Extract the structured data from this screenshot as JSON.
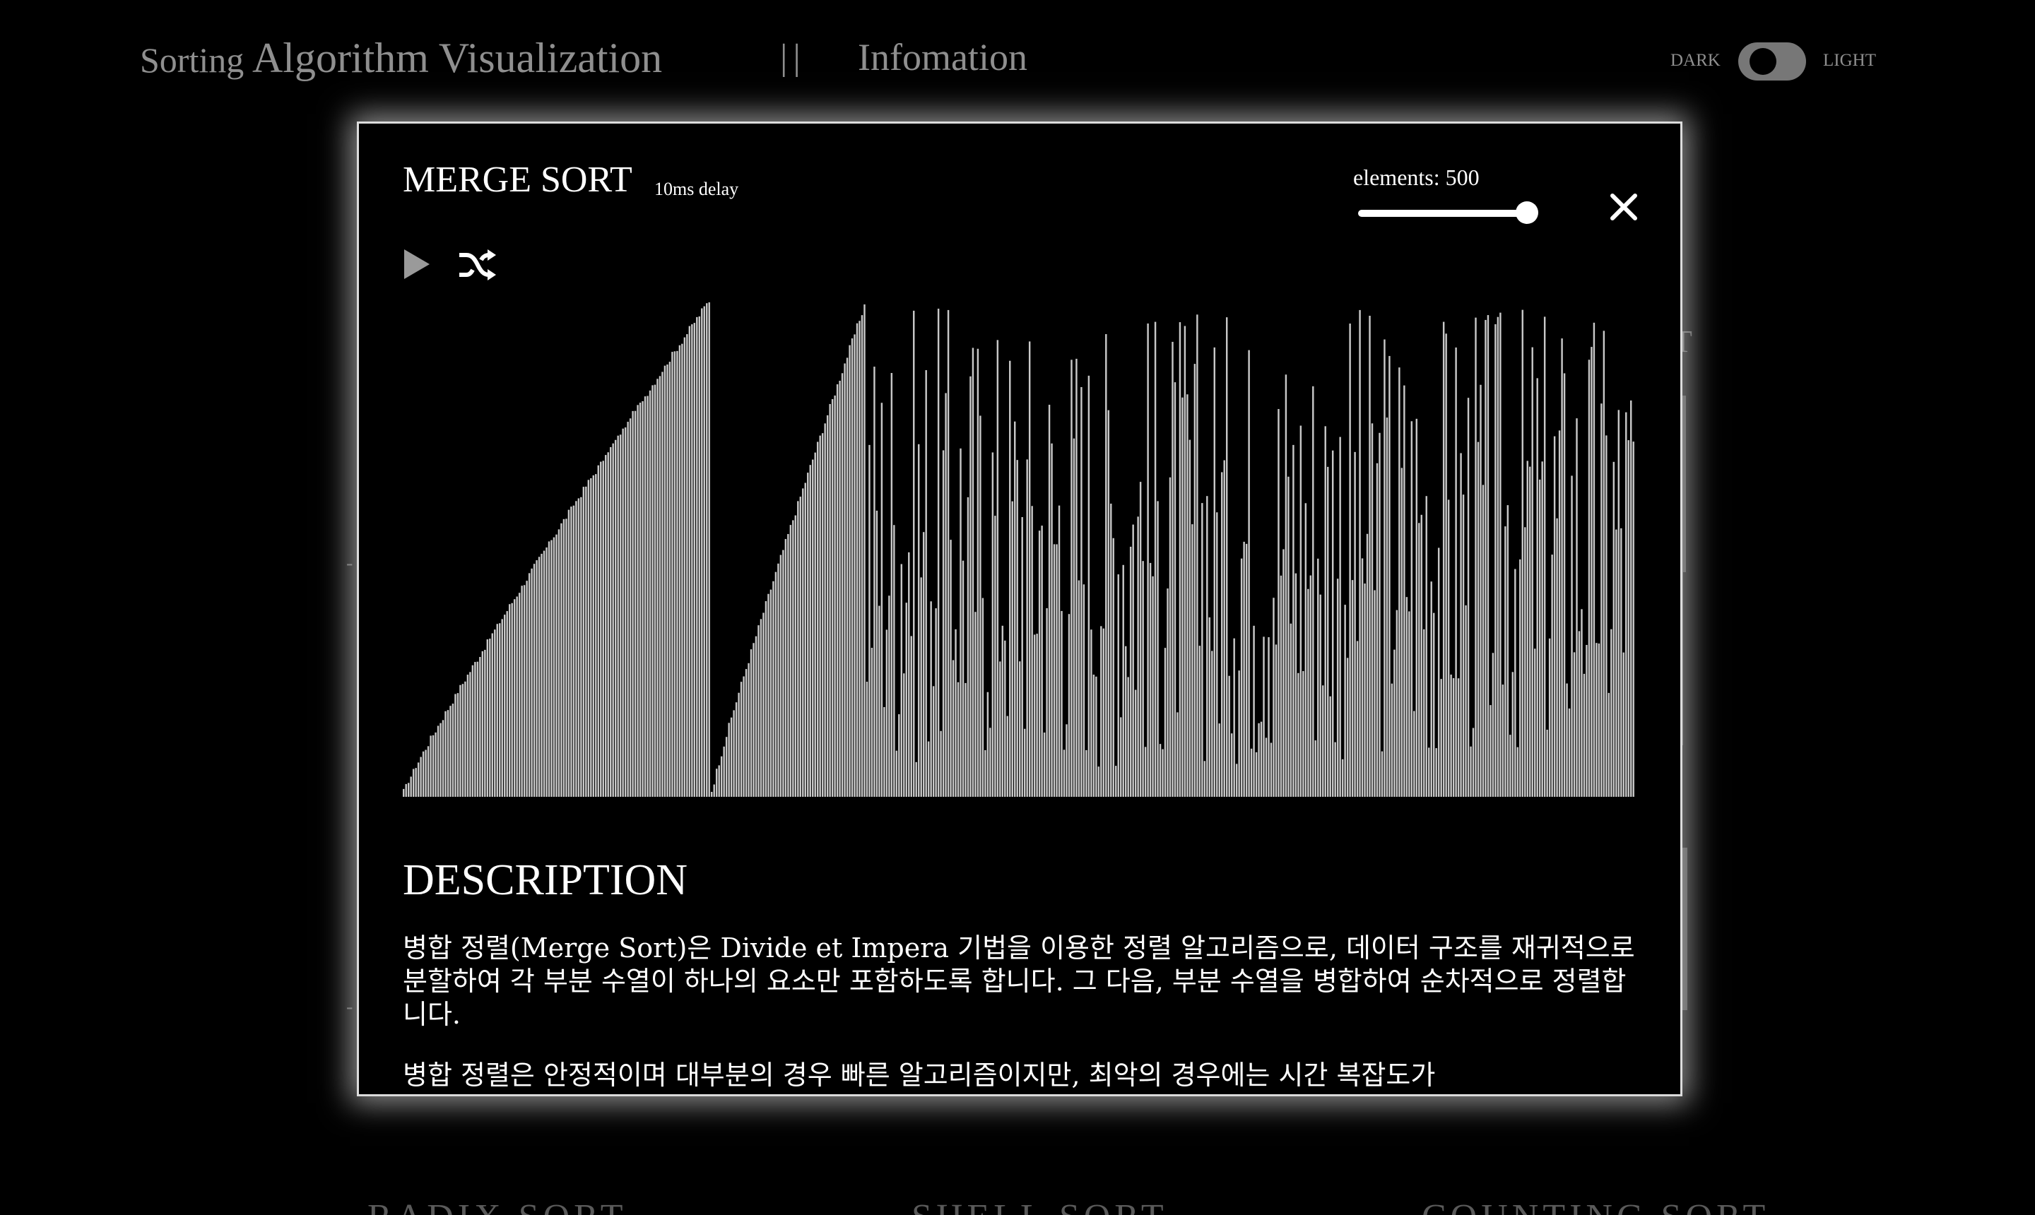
{
  "nav": {
    "title_word1": "Sorting",
    "title_rest": "Algorithm Visualization",
    "separator": "||",
    "info_link": "Infomation",
    "theme_dark": "DARK",
    "theme_light": "LIGHT",
    "theme_mode": "dark"
  },
  "background": {
    "card_labels": [
      "RADIX SORT",
      "SHELL SORT",
      "COUNTING SORT"
    ],
    "partial_title_letter": "T"
  },
  "modal": {
    "algorithm_title": "MERGE SORT",
    "delay_label": "10ms delay",
    "elements_label": "elements: 500",
    "elements_value": 500,
    "slider_fraction": 1.0,
    "close_icon": "close-icon",
    "play_icon": "play-icon",
    "shuffle_icon": "shuffle-icon",
    "bar_color": "#c8c8c8",
    "description_heading": "DESCRIPTION",
    "description_p1": "병합 정렬(Merge Sort)은 Divide et Impera 기법을 이용한 정렬 알고리즘으로, 데이터 구조를 재귀적으로 분할하여 각 부분 수열이 하나의 요소만 포함하도록 합니다. 그 다음, 부분 수열을 병합하여 순차적으로 정렬합니다.",
    "description_p2": "병합 정렬은 안정적이며 대부분의 경우 빠른 알고리즘이지만, 최악의 경우에는 시간 복잡도가"
  },
  "chart_data": {
    "type": "bar",
    "element_count": 500,
    "value_range": [
      0,
      1
    ],
    "segments": [
      {
        "state": "sorted",
        "count": 125,
        "start": 0.01,
        "end": 1.0
      },
      {
        "state": "sorted",
        "count": 63,
        "start": 0.01,
        "end": 0.99
      },
      {
        "state": "unsorted",
        "count": 312
      }
    ]
  }
}
